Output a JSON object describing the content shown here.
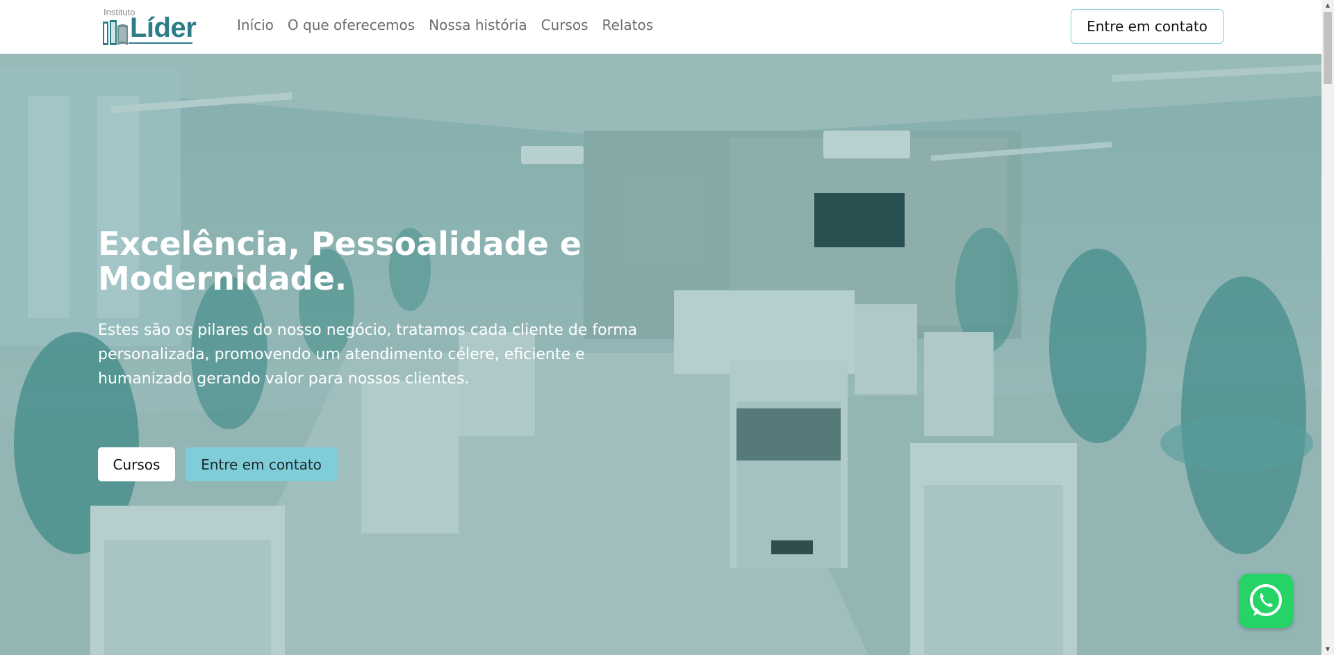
{
  "brand": {
    "logo_small": "Instituto",
    "logo_big": "Líder"
  },
  "nav": {
    "items": [
      {
        "label": "Início"
      },
      {
        "label": "O que oferecemos"
      },
      {
        "label": "Nossa história"
      },
      {
        "label": "Cursos"
      },
      {
        "label": "Relatos"
      }
    ],
    "cta_label": "Entre em contato"
  },
  "hero": {
    "title": "Excelência, Pessoalidade e Modernidade.",
    "text": "Estes são os pilares do nosso negócio, tratamos cada cliente de forma personalizada, promovendo um atendimento célere, eficiente e humanizado gerando valor para nossos clientes.",
    "primary_button": "Cursos",
    "secondary_button": "Entre em contato"
  },
  "colors": {
    "brand": "#2d7d86",
    "accent": "#7fcdd9",
    "whatsapp": "#25d366"
  },
  "icons": {
    "floating": "whatsapp-icon"
  }
}
